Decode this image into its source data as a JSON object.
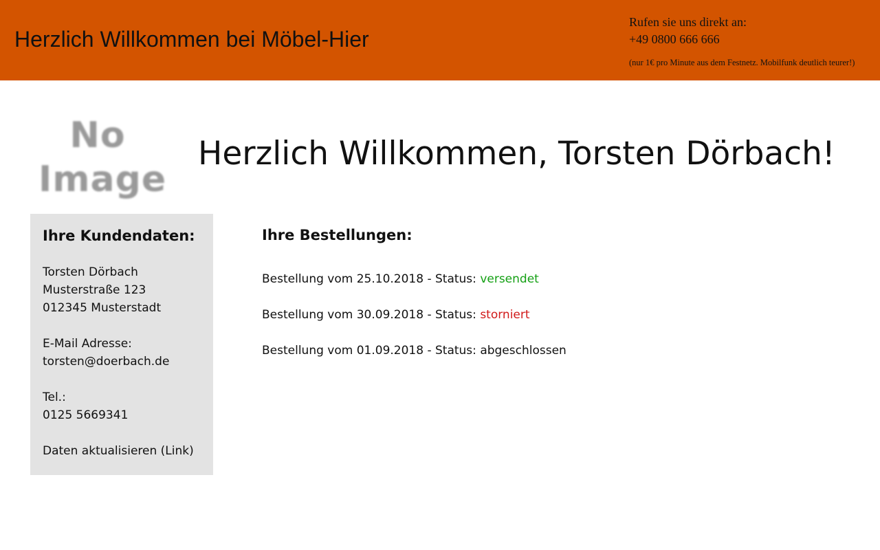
{
  "header": {
    "title": "Herzlich Willkommen bei Möbel-Hier",
    "contact_label": "Rufen sie uns direkt an:",
    "phone": "+49 0800 666 666",
    "note": "(nur 1€ pro Minute aus dem Festnetz. Mobilfunk deutlich teurer!)",
    "background_color": "#d35400"
  },
  "avatar": {
    "line1": "No",
    "line2": "Image"
  },
  "welcome": {
    "heading": "Herzlich Willkommen, Torsten Dörbach!"
  },
  "customer": {
    "heading": "Ihre Kundendaten:",
    "name": "Torsten Dörbach",
    "street": "Musterstraße 123",
    "city": "012345 Musterstadt",
    "email_label": "E-Mail Adresse:",
    "email": "torsten@doerbach.de",
    "phone_label": "Tel.:",
    "phone": "0125 5669341",
    "update_link": "Daten aktualisieren (Link)"
  },
  "orders": {
    "heading": "Ihre Bestellungen:",
    "items": [
      {
        "prefix": "Bestellung vom 25.10.2018 - Status: ",
        "status": "versendet",
        "status_color": "#14a014"
      },
      {
        "prefix": "Bestellung vom 30.09.2018 - Status: ",
        "status": "storniert",
        "status_color": "#d11a1a"
      },
      {
        "prefix": "Bestellung vom 01.09.2018 - Status: ",
        "status": "abgeschlossen",
        "status_color": "#111111"
      }
    ]
  }
}
